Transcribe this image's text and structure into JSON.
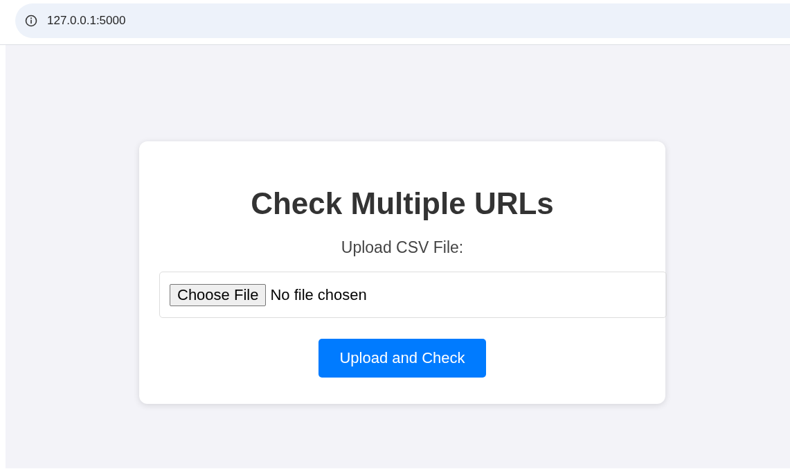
{
  "browser": {
    "address": "127.0.0.1:5000"
  },
  "form": {
    "title": "Check Multiple URLs",
    "label": "Upload CSV File:",
    "file_button": "Choose File",
    "file_status": "No file chosen",
    "submit": "Upload and Check"
  }
}
